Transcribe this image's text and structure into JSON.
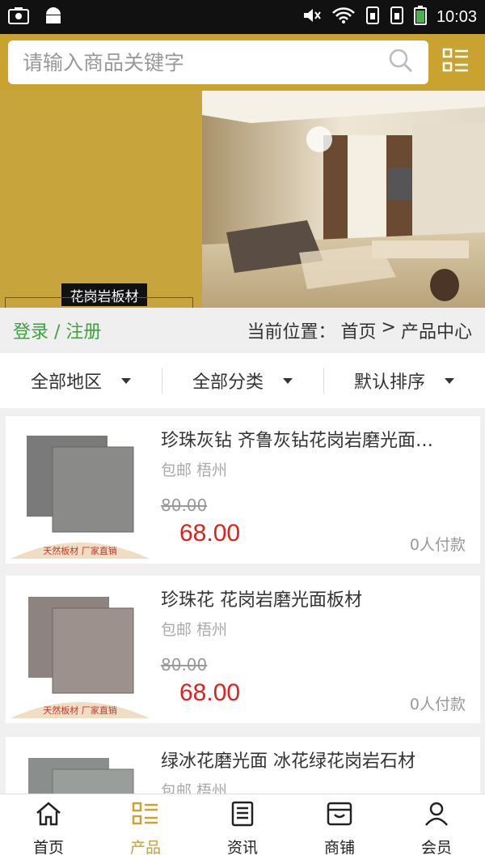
{
  "status_bar": {
    "time": "10:03"
  },
  "search": {
    "placeholder": "请输入商品关键字"
  },
  "banner": {
    "caption": "花岗岩板材"
  },
  "breadcrumb": {
    "login": "登录 / 注册",
    "prefix": "当前位置：",
    "home": "首页",
    "separator": ">",
    "current": "产品中心"
  },
  "filters": [
    {
      "label": "全部地区"
    },
    {
      "label": "全部分类"
    },
    {
      "label": "默认排序"
    }
  ],
  "products": [
    {
      "title": "珍珠灰钻 齐鲁灰钻花岗岩磨光面…",
      "meta": "包邮 梧州",
      "old_price": "80.00",
      "price": "68.00",
      "sold": "0人付款",
      "banner_text": "天然板材  厂家直销"
    },
    {
      "title": "珍珠花 花岗岩磨光面板材",
      "meta": "包邮 梧州",
      "old_price": "80.00",
      "price": "68.00",
      "sold": "0人付款",
      "banner_text": "天然板材  厂家直销"
    },
    {
      "title": "绿冰花磨光面 冰花绿花岗岩石材",
      "meta": "包邮 梧州",
      "old_price": "",
      "price": "",
      "sold": "",
      "banner_text": ""
    }
  ],
  "tabs": [
    {
      "label": "首页",
      "icon": "home-icon"
    },
    {
      "label": "产品",
      "icon": "list-icon",
      "active": true
    },
    {
      "label": "资讯",
      "icon": "news-icon"
    },
    {
      "label": "商铺",
      "icon": "shop-icon"
    },
    {
      "label": "会员",
      "icon": "user-icon"
    }
  ],
  "colors": {
    "accent": "#c9a230",
    "price": "#e0201c",
    "login": "#3aa53a"
  }
}
